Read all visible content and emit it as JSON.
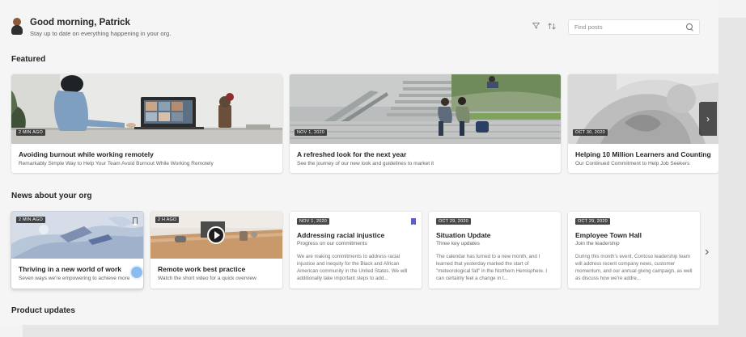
{
  "header": {
    "greeting": "Good morning, Patrick",
    "subtitle": "Stay up to date on everything happening in your org.",
    "search_placeholder": "Find posts"
  },
  "sections": {
    "featured": "Featured",
    "news": "News about your org",
    "product": "Product updates"
  },
  "featured": [
    {
      "badge": "2 MIN AGO",
      "title": "Avoiding burnout while working remotely",
      "subtitle": "Remarkably Simple Way to Help Your Team Avoid Burnout While Working Remotely"
    },
    {
      "badge": "NOV 1, 2020",
      "title": "A refreshed look for the next year",
      "subtitle": "See the journey of our new look and guidelines to market it"
    },
    {
      "badge": "OCT 30, 2020",
      "title": "Helping 10 Million Learners and Counting",
      "subtitle": "Our Continued Commitment to Help Job Seekers"
    }
  ],
  "news": [
    {
      "badge": "2 MIN AGO",
      "title": "Thriving in a new world of work",
      "subtitle": "Seven ways we're empowering to achieve more"
    },
    {
      "badge": "2 H AGO",
      "title": "Remote work best practice",
      "subtitle": "Watch the short video for a quick overview"
    },
    {
      "badge": "NOV 1, 2020",
      "title": "Addressing racial injustice",
      "subtitle": "Progress on our commitments",
      "body": "We are making commitments to address racial injustice and inequity for the Black and African American community in the United States. We will additionally take important steps to add..."
    },
    {
      "badge": "OCT 29, 2020",
      "title": "Situation Update",
      "subtitle": "Three key updates",
      "body": "The calendar has turned to a new month, and I learned that yesterday marked the start of \"meteorological fall\" in the Northern Hemisphere. I can certainly feel a change in t..."
    },
    {
      "badge": "OCT 29, 2020",
      "title": "Employee Town Hall",
      "subtitle": "Join the leadership",
      "body": "During this month's event, Contoso leadership team will address recent company news, customer momentum, and our annual giving campaign, as well as discuss how we're addre..."
    }
  ],
  "colors": {
    "accent": "#5b5fc7",
    "background": "#f5f5f5",
    "card": "#ffffff"
  },
  "icons": {
    "filter": "filter-icon",
    "sort": "sort-icon",
    "search": "search-icon",
    "next": "chevron-right-icon",
    "bookmark": "bookmark-icon",
    "play": "play-icon"
  }
}
